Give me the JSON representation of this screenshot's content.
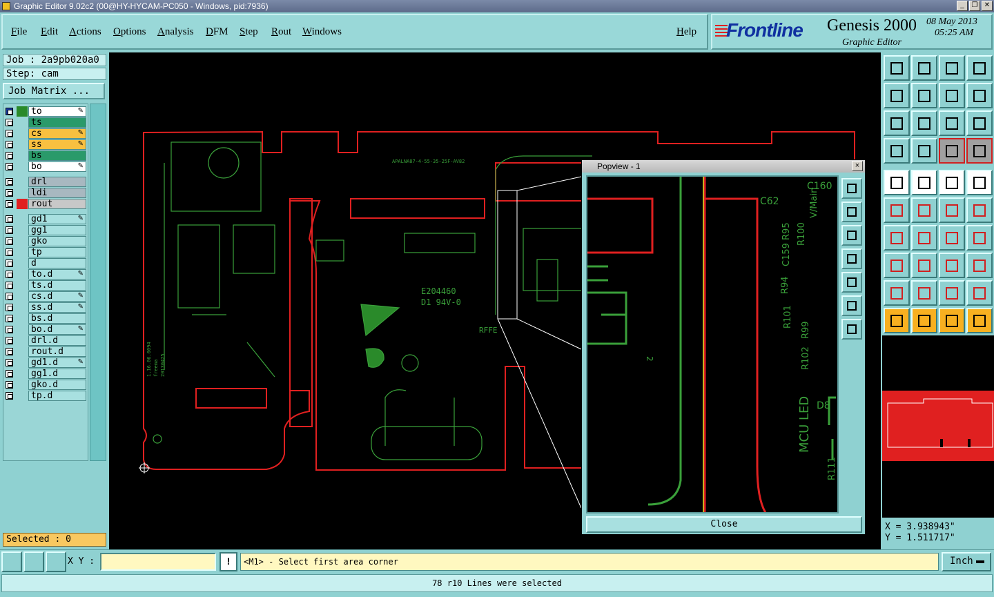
{
  "window": {
    "title": "Graphic Editor 9.02c2 (00@HY-HYCAM-PC050 - Windows, pid:7936)",
    "buttons": [
      "_",
      "❐",
      "✕"
    ]
  },
  "menu": {
    "items": [
      "File",
      "Edit",
      "Actions",
      "Options",
      "Analysis",
      "DFM",
      "Step",
      "Rout",
      "Windows"
    ],
    "help": "Help"
  },
  "brand": {
    "logo": "Frontline",
    "product": "Genesis 2000",
    "subtitle": "Graphic Editor",
    "date": "08 May 2013",
    "time": "05:25 AM"
  },
  "job": {
    "job_label": "Job : 2a9pb020a0",
    "step_label": "Step: cam",
    "matrix_button": "Job Matrix ..."
  },
  "layers": [
    {
      "name": "to",
      "color": "#2a8a2a",
      "bg": "#ffffff",
      "edit": true,
      "sel": true
    },
    {
      "name": "ts",
      "color": "",
      "bg": "#2a9a6a"
    },
    {
      "name": "cs",
      "color": "",
      "bg": "#f8c040",
      "edit": true
    },
    {
      "name": "ss",
      "color": "",
      "bg": "#f8c040",
      "edit": true
    },
    {
      "name": "bs",
      "color": "",
      "bg": "#2a9a6a"
    },
    {
      "name": "bo",
      "color": "",
      "bg": "#ffffff",
      "edit": true
    },
    {
      "name": "drl",
      "color": "",
      "bg": "#a8b8c0"
    },
    {
      "name": "ldi",
      "color": "",
      "bg": "#a8b8c0"
    },
    {
      "name": "rout",
      "color": "#e02020",
      "bg": "#c8c8c8"
    },
    {
      "name": "gd1",
      "color": "",
      "bg": "#a8e0e0",
      "edit": true
    },
    {
      "name": "gg1",
      "color": "",
      "bg": "#a8e0e0"
    },
    {
      "name": "gko",
      "color": "",
      "bg": "#a8e0e0"
    },
    {
      "name": "tp",
      "color": "",
      "bg": "#a8e0e0"
    },
    {
      "name": "d",
      "color": "",
      "bg": "#a8e0e0"
    },
    {
      "name": "to.d",
      "color": "",
      "bg": "#a8e0e0",
      "edit": true
    },
    {
      "name": "ts.d",
      "color": "",
      "bg": "#a8e0e0"
    },
    {
      "name": "cs.d",
      "color": "",
      "bg": "#a8e0e0",
      "edit": true
    },
    {
      "name": "ss.d",
      "color": "",
      "bg": "#a8e0e0",
      "edit": true
    },
    {
      "name": "bs.d",
      "color": "",
      "bg": "#a8e0e0"
    },
    {
      "name": "bo.d",
      "color": "",
      "bg": "#a8e0e0",
      "edit": true
    },
    {
      "name": "drl.d",
      "color": "",
      "bg": "#a8e0e0"
    },
    {
      "name": "rout.d",
      "color": "",
      "bg": "#a8e0e0"
    },
    {
      "name": "gd1.d",
      "color": "",
      "bg": "#a8e0e0",
      "edit": true
    },
    {
      "name": "gg1.d",
      "color": "",
      "bg": "#a8e0e0"
    },
    {
      "name": "gko.d",
      "color": "",
      "bg": "#a8e0e0"
    },
    {
      "name": "tp.d",
      "color": "",
      "bg": "#a8e0e0"
    }
  ],
  "selected": "Selected : 0",
  "board_text": {
    "cert": "E204460",
    "rating": "D1  94V-0",
    "rffe": "RFFE",
    "date_code": "1.16.06.0094",
    "maker": "freema",
    "date": "20130425",
    "top_label": "APALNA87-4-55-35-25F-AV82"
  },
  "popview": {
    "title": "Popview - 1",
    "close_label": "Close",
    "labels": {
      "c160": "C160",
      "c62": "C62",
      "vmain": "V/Main",
      "r95": "C159 R95",
      "r100": "R100",
      "r94": "R94",
      "r101": "R101",
      "r99": "R99",
      "r102": "R102",
      "mcu": "MCU LED",
      "d8": "D8",
      "r111": "R111",
      "n2": "2"
    }
  },
  "coords": {
    "x": "X = 3.938943\"",
    "y": "Y = 1.511717\""
  },
  "bottom": {
    "xy_label": "X Y :",
    "xy_value": "",
    "warn": "!",
    "prompt": "<M1> - Select first area corner",
    "unit": "Inch",
    "status": "78 r10 Lines were selected"
  },
  "icons": [
    "pan-up-icon",
    "pan-down-icon",
    "home-icon",
    "split-view-icon",
    "pan-left-icon",
    "pan-right-icon",
    "zoom-window-icon",
    "redraw-icon",
    "zoom-fit-icon",
    "zoom-center-icon",
    "zoom-1to2-icon",
    "help-icon",
    "measure-icon",
    "snap-icon",
    "layer-select-icon",
    "layer-select-2-icon",
    "feature-add-icon",
    "line-draw-icon",
    "ruler-icon",
    "pad-icon",
    "connect-icon",
    "delete-icon",
    "move-icon",
    "resize-icon",
    "angle-icon",
    "line-icon",
    "arc-icon",
    "mirror-icon",
    "scale-icon",
    "measure-between-icon",
    "dimension-icon",
    "group-icon",
    "polygon-icon",
    "polygon-2-icon",
    "polygon-3-icon",
    "polygon-4-icon",
    "select-pointer-icon",
    "select-box-icon",
    "select-point-icon",
    "select-net-icon"
  ]
}
